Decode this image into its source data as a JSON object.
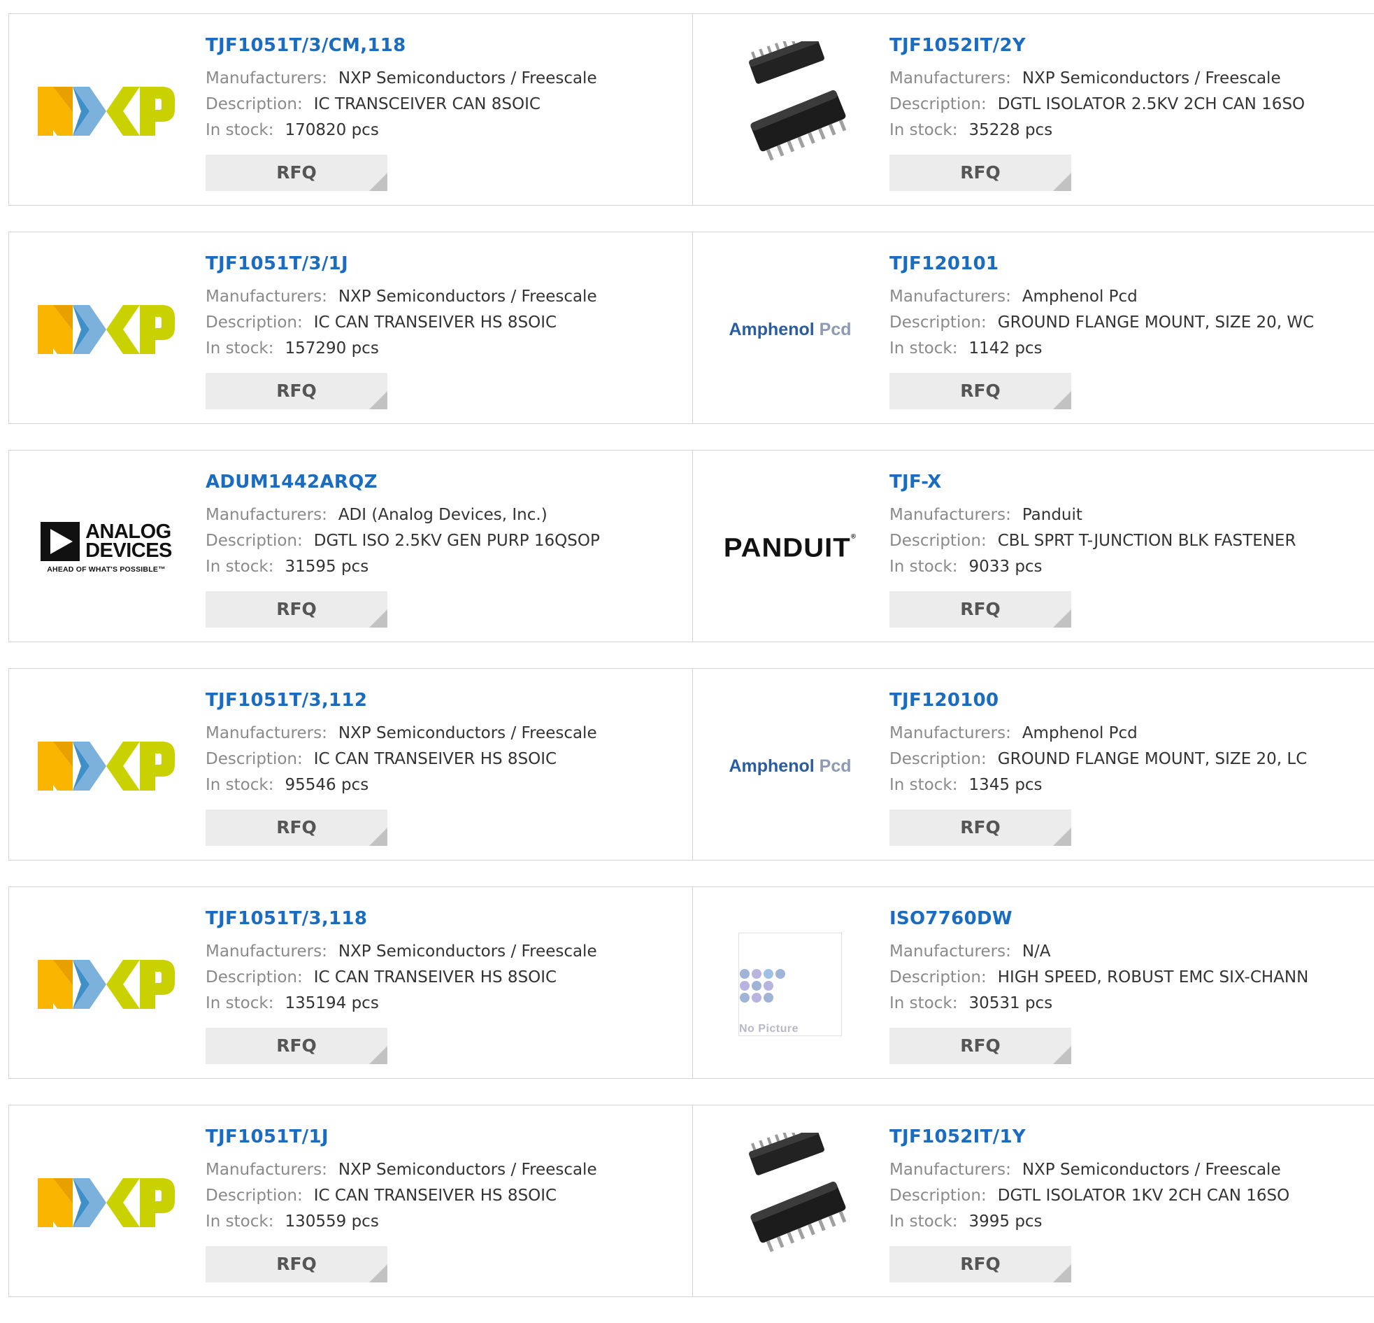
{
  "labels": {
    "manufacturers": "Manufacturers:",
    "description": "Description:",
    "in_stock": "In stock:",
    "rfq": "RFQ"
  },
  "products": [
    {
      "part": "TJF1051T/3/CM,118",
      "manufacturer": "NXP Semiconductors / Freescale",
      "description": "IC TRANSCEIVER CAN 8SOIC",
      "stock": "170820 pcs",
      "image": "nxp-logo"
    },
    {
      "part": "TJF1052IT/2Y",
      "manufacturer": "NXP Semiconductors / Freescale",
      "description": "DGTL ISOLATOR 2.5KV 2CH CAN 16SO",
      "stock": "35228 pcs",
      "image": "chip-photo"
    },
    {
      "part": "TJF1051T/3/1J",
      "manufacturer": "NXP Semiconductors / Freescale",
      "description": "IC CAN TRANSEIVER HS 8SOIC",
      "stock": "157290 pcs",
      "image": "nxp-logo"
    },
    {
      "part": "TJF120101",
      "manufacturer": "Amphenol Pcd",
      "description": "GROUND FLANGE MOUNT, SIZE 20, WC",
      "stock": "1142 pcs",
      "image": "amphenol-logo"
    },
    {
      "part": "ADUM1442ARQZ",
      "manufacturer": "ADI (Analog Devices, Inc.)",
      "description": "DGTL ISO 2.5KV GEN PURP 16QSOP",
      "stock": "31595 pcs",
      "image": "analog-devices-logo"
    },
    {
      "part": "TJF-X",
      "manufacturer": "Panduit",
      "description": "CBL SPRT T-JUNCTION BLK FASTENER",
      "stock": "9033 pcs",
      "image": "panduit-logo"
    },
    {
      "part": "TJF1051T/3,112",
      "manufacturer": "NXP Semiconductors / Freescale",
      "description": "IC CAN TRANSEIVER HS 8SOIC",
      "stock": "95546 pcs",
      "image": "nxp-logo"
    },
    {
      "part": "TJF120100",
      "manufacturer": "Amphenol Pcd",
      "description": "GROUND FLANGE MOUNT, SIZE 20, LC",
      "stock": "1345 pcs",
      "image": "amphenol-logo"
    },
    {
      "part": "TJF1051T/3,118",
      "manufacturer": "NXP Semiconductors / Freescale",
      "description": "IC CAN TRANSEIVER HS 8SOIC",
      "stock": "135194 pcs",
      "image": "nxp-logo"
    },
    {
      "part": "ISO7760DW",
      "manufacturer": "N/A",
      "description": "HIGH SPEED, ROBUST EMC SIX-CHANN",
      "stock": "30531 pcs",
      "image": "no-picture"
    },
    {
      "part": "TJF1051T/1J",
      "manufacturer": "NXP Semiconductors / Freescale",
      "description": "IC CAN TRANSEIVER HS 8SOIC",
      "stock": "130559 pcs",
      "image": "nxp-logo"
    },
    {
      "part": "TJF1052IT/1Y",
      "manufacturer": "NXP Semiconductors / Freescale",
      "description": "DGTL ISOLATOR 1KV 2CH CAN 16SO",
      "stock": "3995 pcs",
      "image": "chip-photo"
    }
  ],
  "logos": {
    "analog_devices": {
      "line1": "ANALOG",
      "line2": "DEVICES",
      "tagline": "AHEAD OF WHAT'S POSSIBLE™"
    },
    "amphenol": {
      "name": "Amphenol",
      "suffix": "Pcd"
    },
    "panduit": {
      "name": "PANDUIT"
    },
    "no_picture": {
      "text": "No Picture"
    }
  },
  "colors": {
    "link": "#1a6cc1",
    "label": "#8a8a8a",
    "value": "#333333",
    "border": "#d4d4d4",
    "rfq_bg": "#ececec",
    "nxp_orange": "#f9b500",
    "nxp_blue": "#7bb1db",
    "nxp_green": "#c9d200"
  }
}
